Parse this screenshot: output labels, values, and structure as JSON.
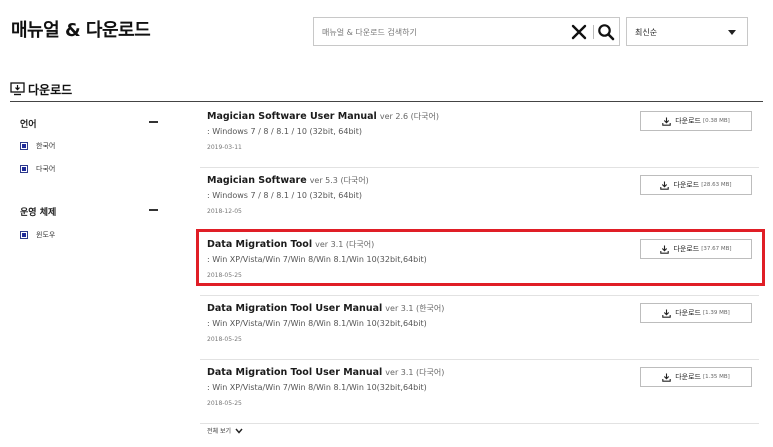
{
  "header": {
    "title": "매뉴얼 & 다운로드"
  },
  "search": {
    "placeholder": "매뉴얼 & 다운로드 검색하기",
    "value": ""
  },
  "sort": {
    "selected": "최신순"
  },
  "section": {
    "title": "다운로드"
  },
  "filters": {
    "language": {
      "title": "언어",
      "options": [
        "한국어",
        "다국어"
      ]
    },
    "os": {
      "title": "운영 체제",
      "options": [
        "윈도우"
      ]
    }
  },
  "downloads": [
    {
      "name": "Magician Software User Manual",
      "version": "ver 2.6 (다국어)",
      "os": ": Windows 7 / 8 / 8.1 / 10 (32bit, 64bit)",
      "date": "2019-03-11",
      "button_label": "다운로드",
      "size": "[0.38 MB]"
    },
    {
      "name": "Magician Software",
      "version": "ver 5.3 (다국어)",
      "os": ": Windows 7 / 8 / 8.1 / 10 (32bit, 64bit)",
      "date": "2018-12-05",
      "button_label": "다운로드",
      "size": "[28.63 MB]"
    },
    {
      "name": "Data Migration Tool",
      "version": "ver 3.1 (다국어)",
      "os": ": Win XP/Vista/Win 7/Win 8/Win 8.1/Win 10(32bit,64bit)",
      "date": "2018-05-25",
      "button_label": "다운로드",
      "size": "[37.67 MB]"
    },
    {
      "name": "Data Migration Tool User Manual",
      "version": "ver 3.1 (한국어)",
      "os": ": Win XP/Vista/Win 7/Win 8/Win 8.1/Win 10(32bit,64bit)",
      "date": "2018-05-25",
      "button_label": "다운로드",
      "size": "[1.39 MB]"
    },
    {
      "name": "Data Migration Tool User Manual",
      "version": "ver 3.1 (다국어)",
      "os": ": Win XP/Vista/Win 7/Win 8/Win 8.1/Win 10(32bit,64bit)",
      "date": "2018-05-25",
      "button_label": "다운로드",
      "size": "[1.35 MB]"
    }
  ],
  "footer": {
    "show_all_label": "전체 보기"
  },
  "colors": {
    "highlight": "#e01e26",
    "checkbox": "#1f2c9a"
  },
  "icons": {
    "clear": "close-icon",
    "search": "search-icon",
    "section": "download-monitor-icon",
    "download": "download-icon",
    "expand": "chevron-down-icon"
  }
}
